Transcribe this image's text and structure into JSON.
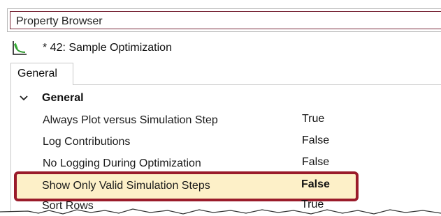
{
  "panel": {
    "title": "Property Browser"
  },
  "object": {
    "icon": "optimization-chart-icon",
    "label": "* 42: Sample Optimization"
  },
  "tabs": [
    {
      "label": "General",
      "active": true
    }
  ],
  "group": {
    "label": "General",
    "expanded": true,
    "icon": "chevron-down-icon"
  },
  "properties": [
    {
      "name": "Always Plot versus Simulation Step",
      "value": "True"
    },
    {
      "name": "Log Contributions",
      "value": "False"
    },
    {
      "name": "No Logging During Optimization",
      "value": "False"
    },
    {
      "name": "Show Only Valid Simulation Steps",
      "value": "False",
      "highlighted": true
    },
    {
      "name": "Sort Rows",
      "value": "True"
    }
  ],
  "colors": {
    "highlight_border": "#9a1b2a",
    "highlight_fill": "#fdf0c8",
    "title_border": "#7a2a3a"
  }
}
